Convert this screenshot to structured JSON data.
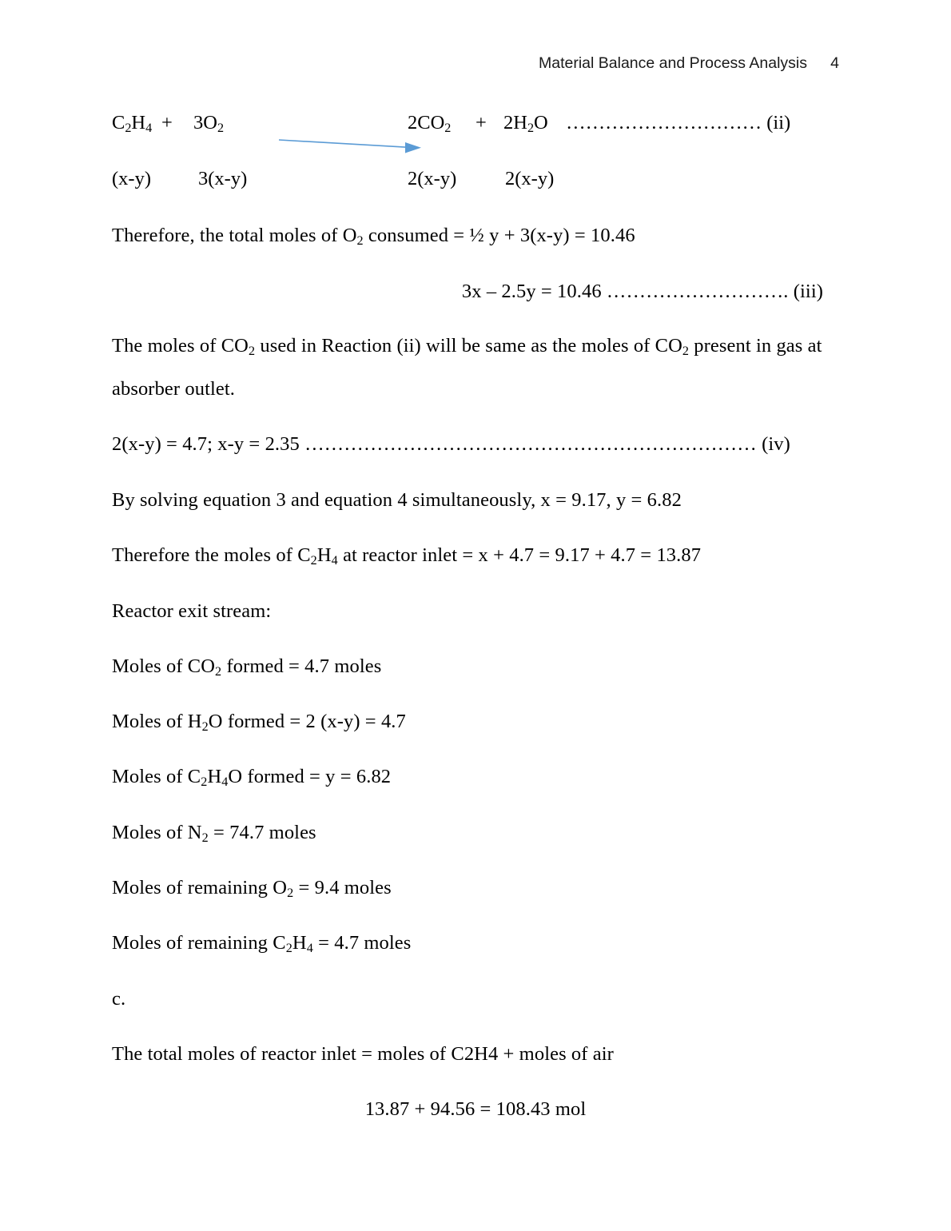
{
  "header": {
    "title": "Material Balance and Process Analysis",
    "page_number": "4"
  },
  "reaction": {
    "reactant_1": "C2H4",
    "plus_1": "+",
    "reactant_2": "3O2",
    "arrow_icon": "right-arrow-icon",
    "arrow_color": "#5b9bd5",
    "product_1": "2CO2",
    "plus_2": "+",
    "product_2": "2H2O",
    "leader": " …………………………",
    "label": " (ii)"
  },
  "coefficients": {
    "c1": "(x-y)",
    "c2": "3(x-y)",
    "c3": "2(x-y)",
    "c4": "2(x-y)"
  },
  "body": {
    "total_o2_consumed": "Therefore, the total moles of O2 consumed = ½ y + 3(x-y) = 10.46",
    "equation_iii": "3x – 2.5y = 10.46 ………………………. (iii)",
    "co2_note_line1": "The moles of CO2 used in Reaction (ii) will be same as the moles of CO2 present in gas at",
    "co2_note_line2": "absorber outlet.",
    "equation_iv": "2(x-y) = 4.7; x-y = 2.35 …………………………………………………………… (iv)",
    "solving": "By solving equation 3 and equation 4 simultaneously, x = 9.17, y = 6.82",
    "c2h4_inlet": "Therefore the moles of C2H4 at reactor inlet = x + 4.7 = 9.17 + 4.7 = 13.87",
    "reactor_exit_heading": "Reactor exit stream:",
    "moles_co2": "Moles of CO2 formed = 4.7 moles",
    "moles_h2o": "Moles of H2O formed = 2 (x-y) = 4.7",
    "moles_c2h4o": "Moles of C2H4O formed = y = 6.82",
    "moles_n2": "Moles of N2 = 74.7 moles",
    "moles_o2_remaining": "Moles of remaining O2 = 9.4 moles",
    "moles_c2h4_remaining": "Moles of remaining C2H4 = 4.7 moles",
    "item_c": "c.",
    "total_inlet": "The total moles of reactor inlet = moles of C2H4 + moles of air",
    "total_inlet_value": "13.87 + 94.56 = 108.43 mol"
  }
}
